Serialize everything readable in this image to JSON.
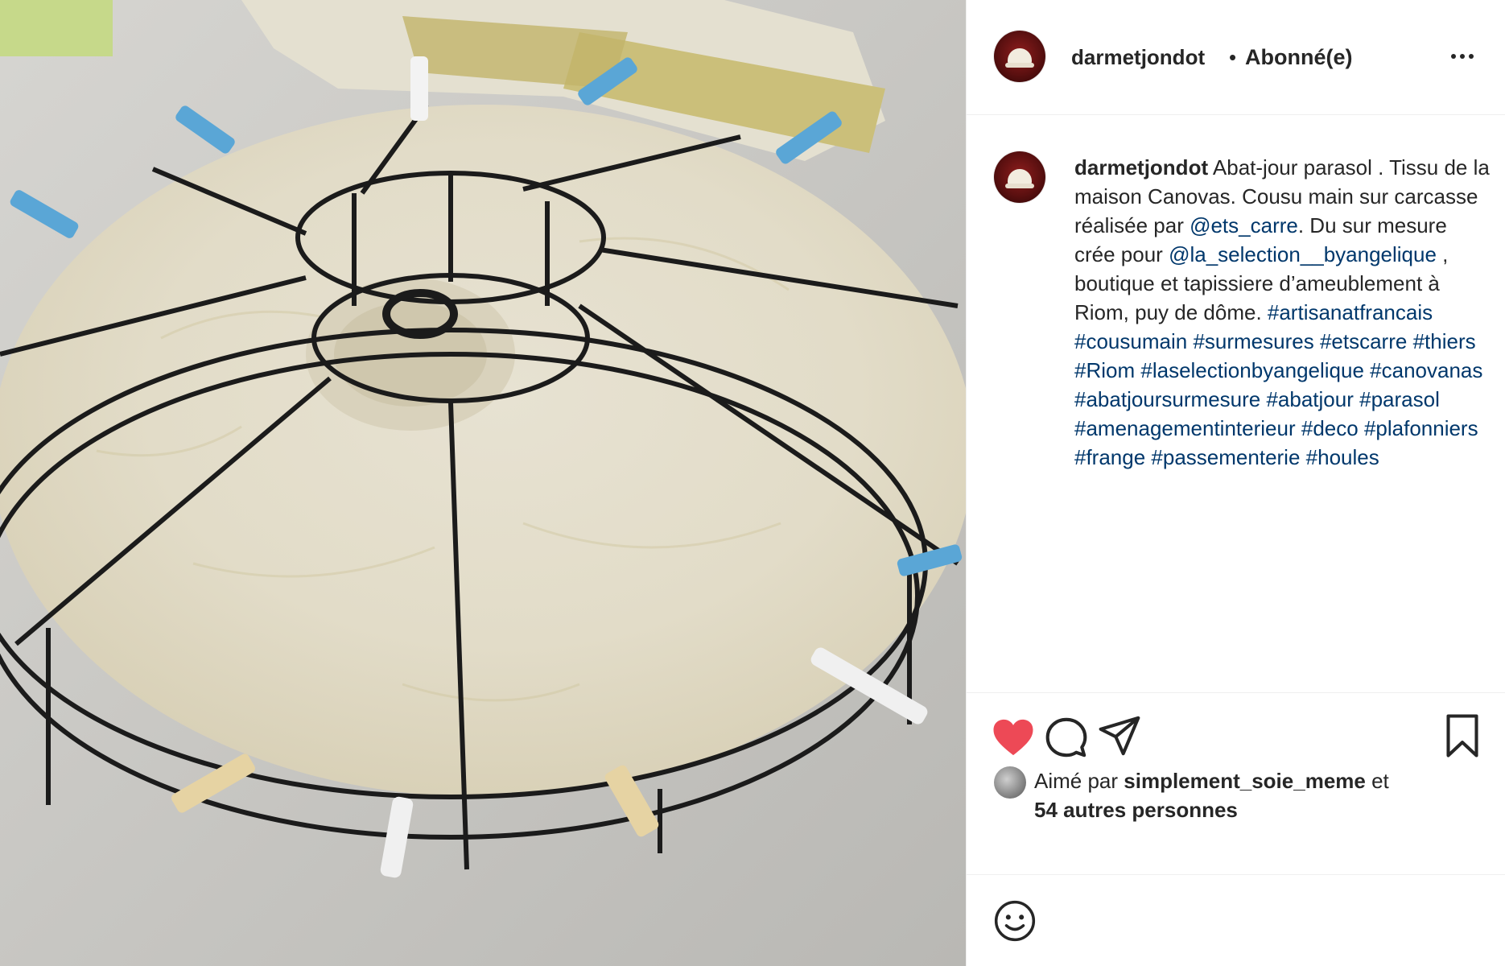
{
  "post": {
    "username": "darmetjondot",
    "separator": "•",
    "follow_status": "Abonné(e)"
  },
  "caption": {
    "username": "darmetjondot",
    "text_part1": " Abat-jour parasol . Tissu de la maison Canovas. Cousu main sur carcasse réalisée par ",
    "mention1": "@ets_carre",
    "text_part2": ". Du sur mesure crée pour ",
    "mention2": "@la_selection__byangelique",
    "text_part3": " , boutique et tapissiere d’ameublement à Riom, puy de dôme. ",
    "hashtags": [
      "#artisanatfrancais",
      "#cousumain",
      "#surmesures",
      "#etscarre",
      "#thiers",
      "#Riom",
      "#laselectionbyangelique",
      "#canovanas",
      "#abatjoursurmesure",
      "#abatjour",
      "#parasol",
      "#amenagementinterieur",
      "#deco",
      "#plafonniers",
      "#frange",
      "#passementerie",
      "#houles"
    ]
  },
  "likes": {
    "prefix": "Aimé par ",
    "user": "simplement_soie_meme",
    "connector": " et",
    "others": "54 autres personnes"
  },
  "icons": {
    "like": "heart-icon",
    "comment": "comment-icon",
    "share": "share-icon",
    "save": "bookmark-icon",
    "emoji": "emoji-icon",
    "more": "more-icon"
  },
  "colors": {
    "like_red": "#ed4956",
    "link_blue": "#00376b",
    "text": "#262626",
    "divider": "#efefef"
  }
}
